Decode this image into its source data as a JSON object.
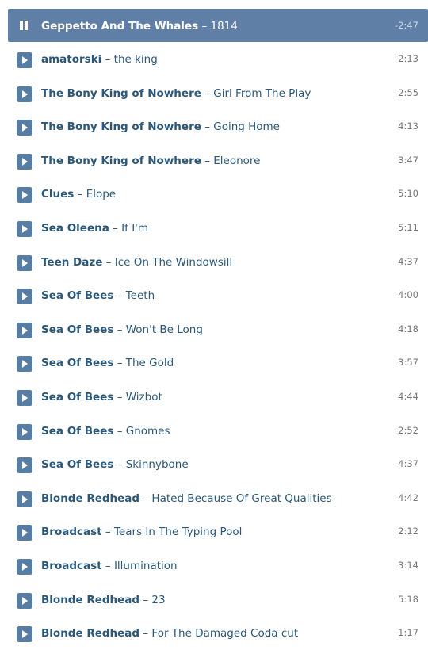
{
  "playlist": {
    "now_playing": {
      "artist": "Geppetto And The Whales",
      "separator": "–",
      "title": "1814",
      "remaining": "-2:47",
      "control_icon": "pause-icon"
    },
    "tracks": [
      {
        "artist": "amatorski",
        "separator": "–",
        "title": "the king",
        "duration": "2:13"
      },
      {
        "artist": "The Bony King of Nowhere",
        "separator": "–",
        "title": "Girl From The Play",
        "duration": "2:55"
      },
      {
        "artist": "The Bony King of Nowhere",
        "separator": "–",
        "title": "Going Home",
        "duration": "4:13"
      },
      {
        "artist": "The Bony King of Nowhere",
        "separator": "–",
        "title": "Eleonore",
        "duration": "3:47"
      },
      {
        "artist": "Clues",
        "separator": "–",
        "title": "Elope",
        "duration": "5:10"
      },
      {
        "artist": "Sea Oleena",
        "separator": "–",
        "title": "If I'm",
        "duration": "5:11"
      },
      {
        "artist": "Teen Daze",
        "separator": "–",
        "title": "Ice On The Windowsill",
        "duration": "4:37"
      },
      {
        "artist": "Sea Of Bees",
        "separator": "–",
        "title": "Teeth",
        "duration": "4:00"
      },
      {
        "artist": "Sea Of Bees",
        "separator": "–",
        "title": "Won't Be Long",
        "duration": "4:18"
      },
      {
        "artist": "Sea Of Bees",
        "separator": "–",
        "title": "The Gold",
        "duration": "3:57"
      },
      {
        "artist": "Sea Of Bees",
        "separator": "–",
        "title": "Wizbot",
        "duration": "4:44"
      },
      {
        "artist": "Sea Of Bees",
        "separator": "–",
        "title": "Gnomes",
        "duration": "2:52"
      },
      {
        "artist": "Sea Of Bees",
        "separator": "–",
        "title": "Skinnybone",
        "duration": "4:37"
      },
      {
        "artist": "Blonde Redhead",
        "separator": "–",
        "title": "Hated Because Of Great Qualities",
        "duration": "4:42"
      },
      {
        "artist": "Broadcast",
        "separator": "–",
        "title": "Tears In The Typing Pool",
        "duration": "2:12"
      },
      {
        "artist": "Broadcast",
        "separator": "–",
        "title": "Illumination",
        "duration": "3:14"
      },
      {
        "artist": "Blonde Redhead",
        "separator": "–",
        "title": "23",
        "duration": "5:18"
      },
      {
        "artist": "Blonde Redhead",
        "separator": "–",
        "title": "For The Damaged Coda cut",
        "duration": "1:17"
      }
    ],
    "track_control_icon": "play-icon"
  },
  "colors": {
    "active_row_bg": "#5f7fa7",
    "play_button_bg": "#587da3",
    "link_text": "#2b587a",
    "duration_text": "#777777"
  }
}
